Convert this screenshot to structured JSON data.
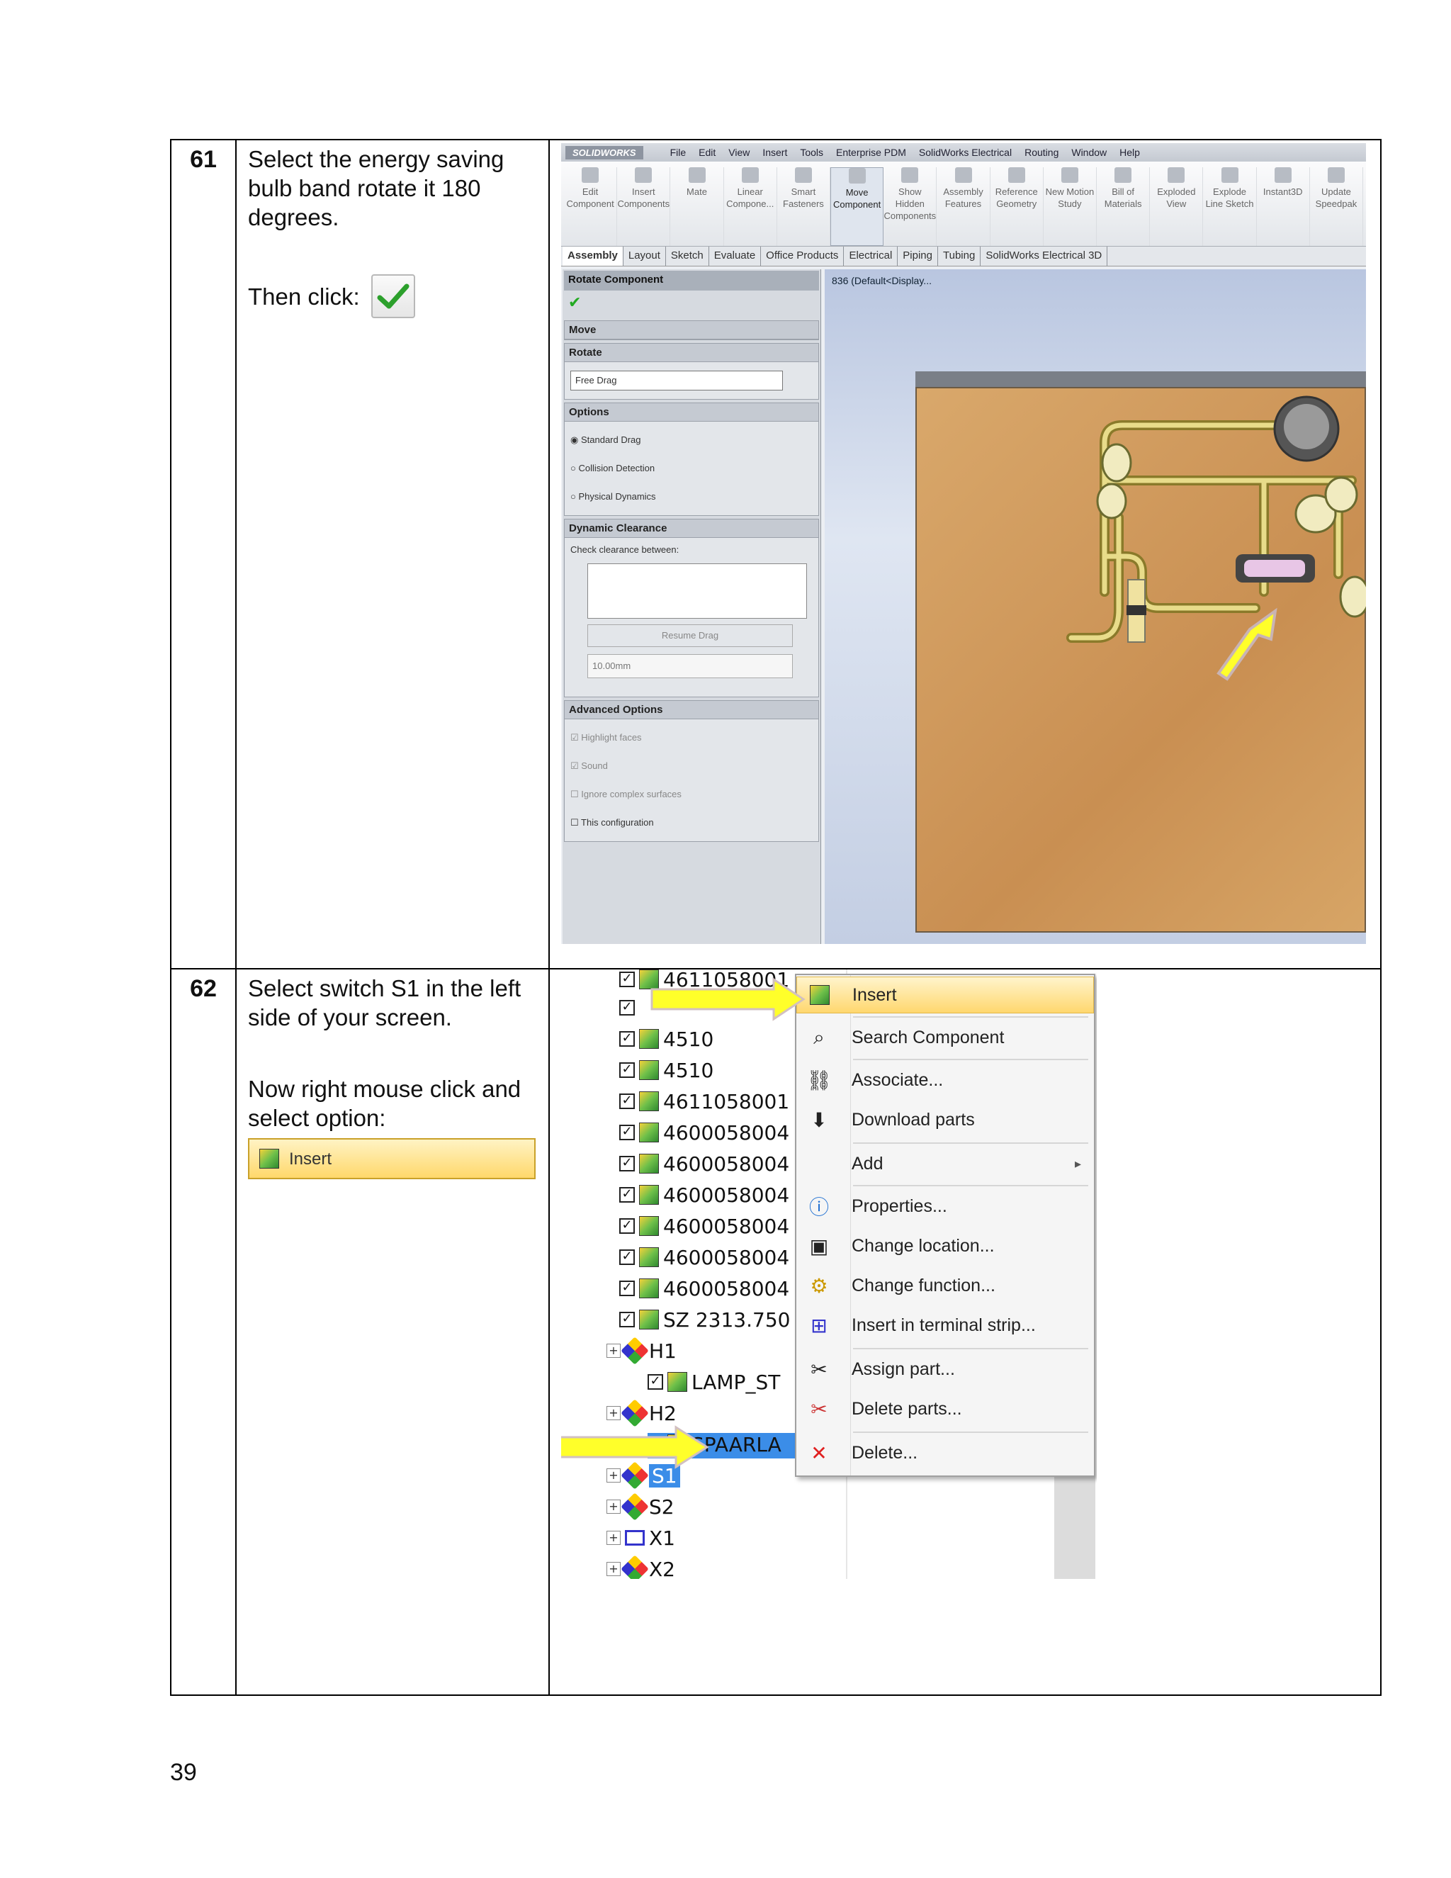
{
  "page_number": "39",
  "steps": [
    {
      "number": "61",
      "text_1": "Select the energy saving bulb band rotate it 180 degrees.",
      "text_2": "Then click:",
      "screenshot": {
        "menubar": [
          "File",
          "Edit",
          "View",
          "Insert",
          "Tools",
          "Enterprise PDM",
          "SolidWorks Electrical",
          "Routing",
          "Window",
          "Help"
        ],
        "logo": "SOLIDWORKS",
        "ribbon": [
          "Edit Component",
          "Insert Components",
          "Mate",
          "Linear Compone...",
          "Smart Fasteners",
          "Move Component",
          "Show Hidden Components",
          "Assembly Features",
          "Reference Geometry",
          "New Motion Study",
          "Bill of Materials",
          "Exploded View",
          "Explode Line Sketch",
          "Instant3D",
          "Update Speedpak"
        ],
        "tabs": [
          "Assembly",
          "Layout",
          "Sketch",
          "Evaluate",
          "Office Products",
          "Electrical",
          "Piping",
          "Tubing",
          "SolidWorks Electrical 3D"
        ],
        "panel_title": "Rotate Component",
        "move_header": "Move",
        "rotate_header": "Rotate",
        "rotate_value": "Free Drag",
        "options_header": "Options",
        "options": [
          "Standard Drag",
          "Collision Detection",
          "Physical Dynamics"
        ],
        "dyn_header": "Dynamic Clearance",
        "dyn_label": "Check clearance between:",
        "resume_btn": "Resume Drag",
        "distance": "10.00mm",
        "adv_header": "Advanced Options",
        "adv_options": [
          "Highlight faces",
          "Sound",
          "Ignore complex surfaces",
          "This configuration"
        ],
        "tree_label": "836 (Default<Display..."
      }
    },
    {
      "number": "62",
      "text_1": "Select switch S1 in the left side of your screen.",
      "text_2": "Now right mouse click and select option:",
      "chip_label": "Insert",
      "screenshot": {
        "tree_items": [
          "4611058001",
          "",
          "4510",
          "4510",
          "4611058001",
          "4600058004",
          "4600058004",
          "4600058004",
          "4600058004",
          "4600058004",
          "4600058004",
          "SZ 2313.750",
          "H1",
          "LAMP_ST",
          "H2",
          "SPAARLA",
          "S1",
          "S2",
          "X1",
          "X2"
        ],
        "menu_items": [
          "Insert",
          "Search Component",
          "Associate...",
          "Download parts",
          "Add",
          "Properties...",
          "Change location...",
          "Change function...",
          "Insert in terminal strip...",
          "Assign part...",
          "Delete parts...",
          "Delete..."
        ]
      }
    }
  ],
  "colors": {
    "highlight": "#3b8de8",
    "arrow": "#ffff00",
    "menu_hl": "#ffd76e"
  }
}
